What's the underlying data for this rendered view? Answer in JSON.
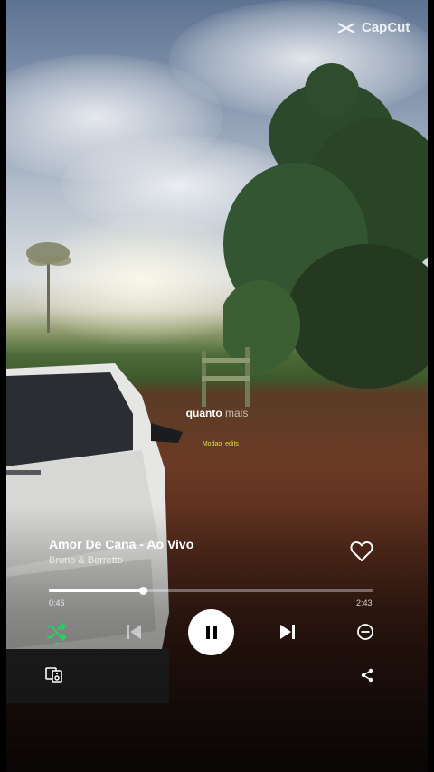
{
  "watermark": {
    "text": "CapCut",
    "icon": "capcut-logo-icon"
  },
  "lyric": {
    "bright": "quanto",
    "dim": "mais"
  },
  "credit": {
    "text": "__Modao_edits"
  },
  "track": {
    "title": "Amor De Cana - Ao Vivo",
    "artist": "Bruno & Barretto",
    "liked": false
  },
  "playback": {
    "current_time": "0:46",
    "total_time": "2:43",
    "progress_fraction": 0.29,
    "state": "playing",
    "shuffle_enabled": true
  },
  "colors": {
    "accent": "#1ed760",
    "text": "#ffffff",
    "credit": "#d8e04a"
  },
  "icons": [
    "heart-icon",
    "shuffle-icon",
    "previous-icon",
    "pause-icon",
    "next-icon",
    "remove-icon",
    "devices-icon",
    "share-icon"
  ]
}
